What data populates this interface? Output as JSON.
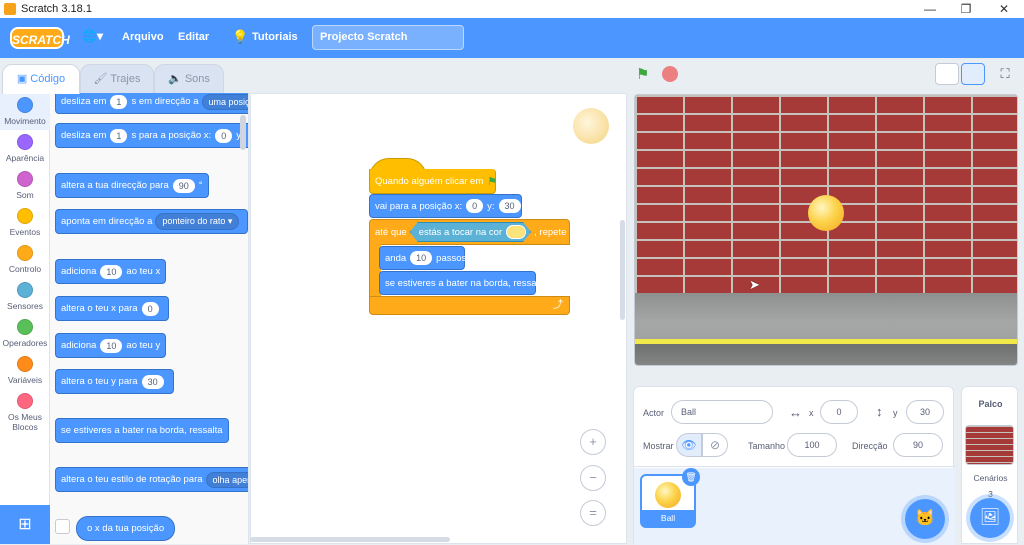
{
  "window": {
    "title": "Scratch 3.18.1",
    "minimize": "—",
    "maximize": "❐",
    "close": "✕"
  },
  "menu": {
    "logo": "SCRATCH",
    "language_icon": "🌐▾",
    "file": "Arquivo",
    "edit": "Editar",
    "tutorials": "Tutoriais",
    "project_title": "Projecto Scratch"
  },
  "tabs": [
    {
      "label": "Código"
    },
    {
      "label": "Trajes"
    },
    {
      "label": "Sons"
    }
  ],
  "categories": [
    {
      "label": "Movimento",
      "color": "#4c97ff"
    },
    {
      "label": "Aparência",
      "color": "#9966ff"
    },
    {
      "label": "Som",
      "color": "#cf63cf"
    },
    {
      "label": "Eventos",
      "color": "#ffbf00"
    },
    {
      "label": "Controlo",
      "color": "#ffab19"
    },
    {
      "label": "Sensores",
      "color": "#5cb1d6"
    },
    {
      "label": "Operadores",
      "color": "#59c059"
    },
    {
      "label": "Variáveis",
      "color": "#ff8c1a"
    },
    {
      "label": "Os Meus Blocos",
      "color": "#ff6680"
    }
  ],
  "palette": {
    "b1": {
      "pre": "desliza em",
      "num": "1",
      "mid": "s em direcção a",
      "drop": "uma posiçã"
    },
    "b2": {
      "pre": "desliza em",
      "num": "1",
      "mid": "s para a posição x:",
      "x": "0",
      "y": "y"
    },
    "b3": {
      "pre": "altera a tua direcção para",
      "num": "90",
      "deg": "°"
    },
    "b4": {
      "pre": "aponta em direcção a",
      "drop": "ponteiro do rato ▾"
    },
    "b5": {
      "pre": "adiciona",
      "num": "10",
      "post": "ao teu x"
    },
    "b6": {
      "pre": "altera o teu x para",
      "num": "0"
    },
    "b7": {
      "pre": "adiciona",
      "num": "10",
      "post": "ao teu y"
    },
    "b8": {
      "pre": "altera o teu y para",
      "num": "30"
    },
    "b9": {
      "label": "se estiveres a bater na borda, ressalta"
    },
    "b10": {
      "pre": "altera o teu estilo de rotação para",
      "drop": "olha apenas"
    },
    "b11": {
      "label": "o x da tua posição"
    }
  },
  "script": {
    "hat": "Quando alguém clicar em",
    "goto_pre": "vai para a posição x:",
    "goto_x": "0",
    "goto_y_label": "y:",
    "goto_y": "30",
    "until_pre": "até que",
    "touching": "estás a tocar na cor",
    "repeat": ", repete",
    "move_pre": "anda",
    "move_num": "10",
    "move_post": "passos",
    "bounce": "se estiveres a bater na borda, ressalta",
    "loop_arrow": "⤴"
  },
  "zoom": {
    "in": "+",
    "out": "−",
    "reset": "="
  },
  "sprite_info": {
    "actor_label": "Actor",
    "actor_name": "Ball",
    "x_label": "x",
    "x_value": "0",
    "y_label": "y",
    "y_value": "30",
    "show_label": "Mostrar",
    "size_label": "Tamanho",
    "size_value": "100",
    "direction_label": "Direcção",
    "direction_value": "90"
  },
  "sprite_list": [
    {
      "name": "Ball"
    }
  ],
  "stage_panel": {
    "title": "Palco",
    "backdrops_label": "Cenários",
    "backdrops_count": "3"
  },
  "colors": {
    "accent": "#4c97ff",
    "motion": "#4c97ff",
    "events": "#ffbf00",
    "control": "#ffab19"
  }
}
